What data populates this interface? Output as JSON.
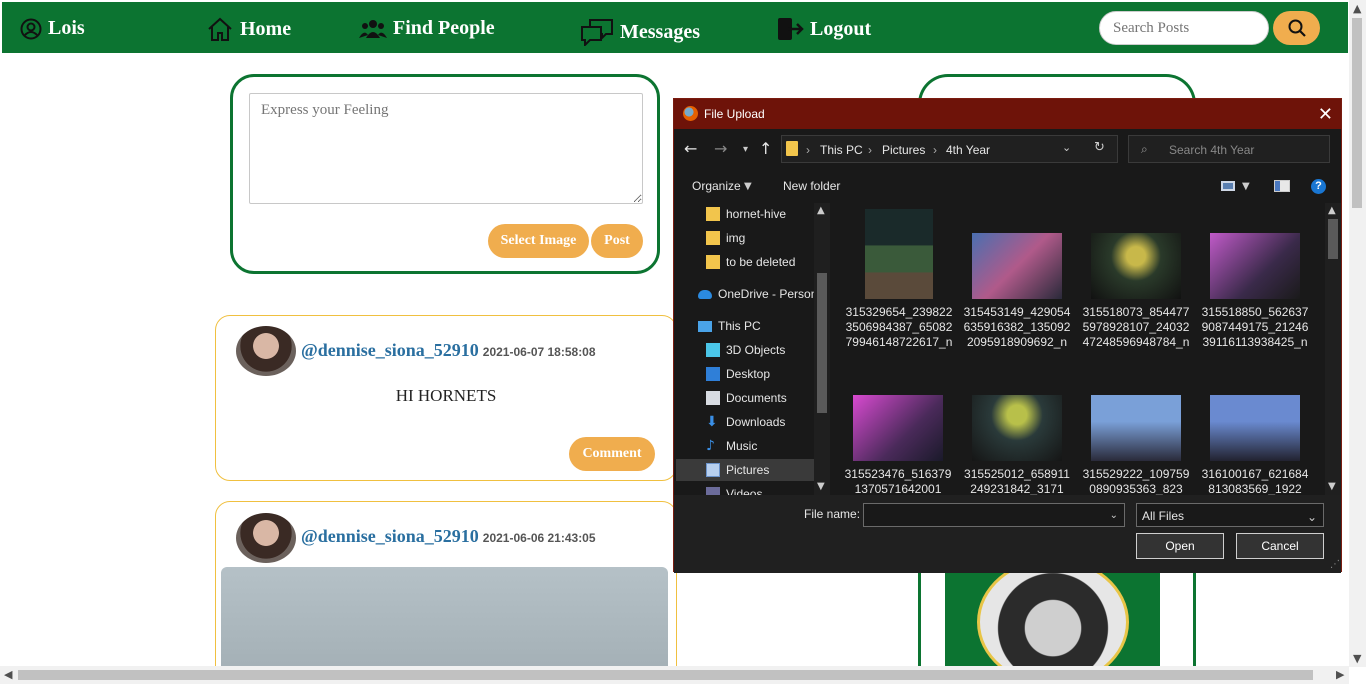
{
  "navbar": {
    "user_name": "Lois",
    "home": "Home",
    "find_people": "Find People",
    "messages": "Messages",
    "logout": "Logout",
    "search_placeholder": "Search Posts"
  },
  "composer": {
    "placeholder": "Express your Feeling",
    "select_image": "Select Image",
    "post": "Post"
  },
  "posts": [
    {
      "user": "@dennise_siona_52910",
      "date": "2021-06-07 18:58:08",
      "text": "HI HORNETS",
      "comment": "Comment"
    },
    {
      "user": "@dennise_siona_52910",
      "date": "2021-06-06 21:43:05"
    }
  ],
  "dialog": {
    "title": "File Upload",
    "breadcrumb": [
      "This PC",
      "Pictures",
      "4th Year"
    ],
    "search_placeholder": "Search 4th Year",
    "organize": "Organize",
    "new_folder": "New folder",
    "tree": [
      "hornet-hive",
      "img",
      "to be deleted",
      "OneDrive - Person",
      "This PC",
      "3D Objects",
      "Desktop",
      "Documents",
      "Downloads",
      "Music",
      "Pictures",
      "Videos"
    ],
    "files": [
      "315329654_2398223506984387_6508279946148722617_n",
      "315453149_429054635916382_1350922095918909692_n",
      "315518073_8544775978928107_2403247248596948784_n",
      "315518850_5626379087449175_2124639116113938425_n",
      "315523476_5163791370571642001",
      "315525012_658911249231842_3171",
      "315529222_1097590890935363_823",
      "316100167_621684813083569_1922"
    ],
    "file_name_label": "File name:",
    "file_name_value": "",
    "file_type": "All Files",
    "open": "Open",
    "cancel": "Cancel"
  }
}
